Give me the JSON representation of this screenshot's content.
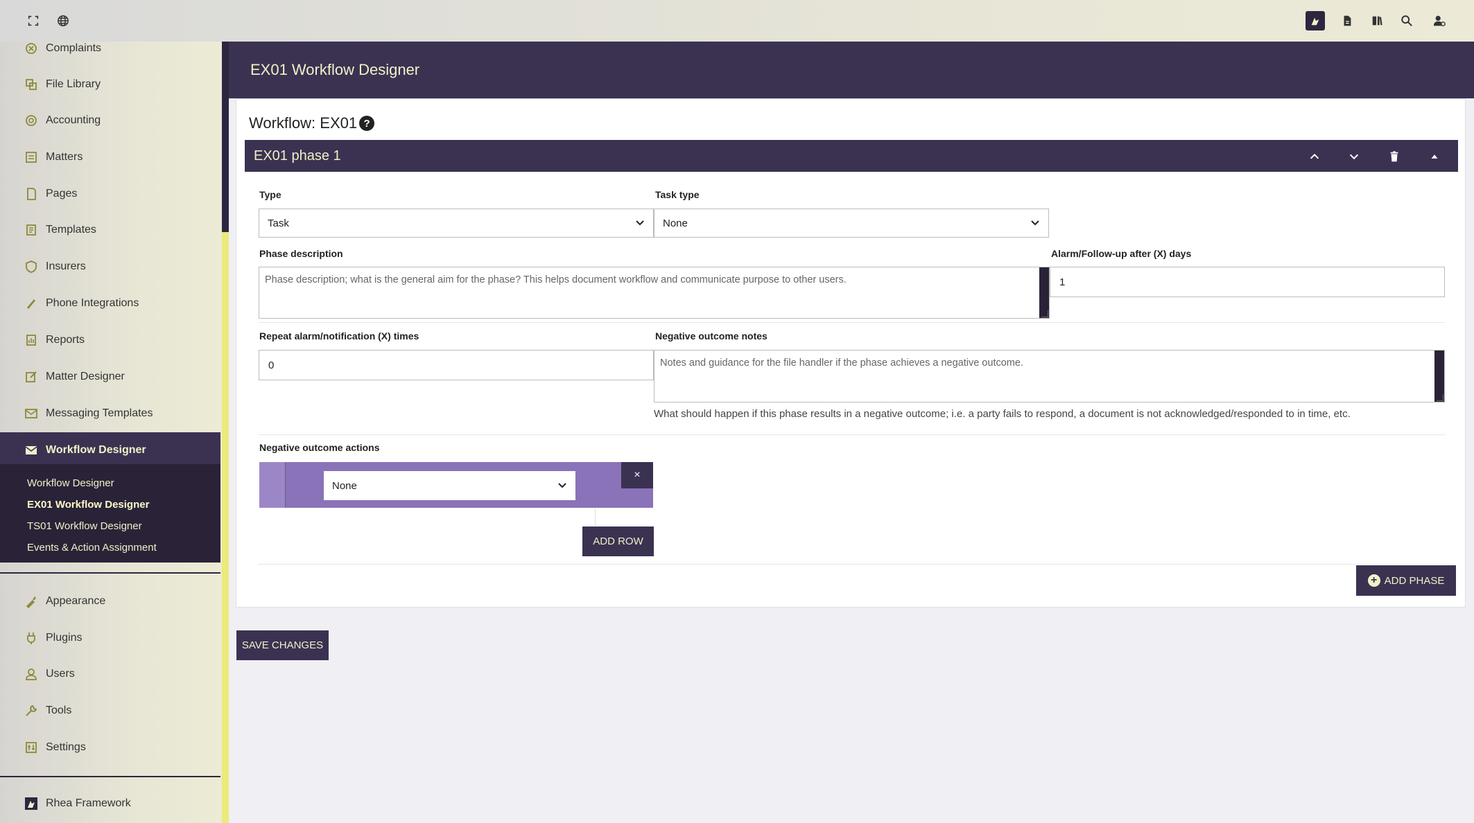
{
  "topbar": {
    "icons": [
      "fullscreen-icon",
      "globe-icon",
      "rhea-logo-icon",
      "document-icon",
      "book-icon",
      "search-icon",
      "user-settings-icon"
    ]
  },
  "sidebar": {
    "items": [
      {
        "label": "Complaints",
        "icon": "complaints-icon"
      },
      {
        "label": "File Library",
        "icon": "file-library-icon"
      },
      {
        "label": "Accounting",
        "icon": "accounting-icon"
      },
      {
        "label": "Matters",
        "icon": "matters-icon"
      },
      {
        "label": "Pages",
        "icon": "pages-icon"
      },
      {
        "label": "Templates",
        "icon": "templates-icon"
      },
      {
        "label": "Insurers",
        "icon": "insurers-icon"
      },
      {
        "label": "Phone Integrations",
        "icon": "phone-icon"
      },
      {
        "label": "Reports",
        "icon": "reports-icon"
      },
      {
        "label": "Matter Designer",
        "icon": "matter-designer-icon"
      },
      {
        "label": "Messaging Templates",
        "icon": "messaging-icon"
      },
      {
        "label": "Workflow Designer",
        "icon": "envelope-icon"
      },
      {
        "label": "Appearance",
        "icon": "appearance-icon"
      },
      {
        "label": "Plugins",
        "icon": "plugins-icon"
      },
      {
        "label": "Users",
        "icon": "users-icon"
      },
      {
        "label": "Tools",
        "icon": "tools-icon"
      },
      {
        "label": "Settings",
        "icon": "settings-icon"
      },
      {
        "label": "Rhea Framework",
        "icon": "rhea-icon"
      }
    ],
    "submenu": [
      "Workflow Designer",
      "EX01 Workflow Designer",
      "TS01 Workflow Designer",
      "Events & Action Assignment"
    ]
  },
  "page": {
    "title": "EX01 Workflow Designer",
    "workflow_label": "Workflow: EX01",
    "help_glyph": "?"
  },
  "phase": {
    "title": "EX01 phase 1",
    "type_label": "Type",
    "type_value": "Task",
    "task_type_label": "Task type",
    "task_type_value": "None",
    "description_label": "Phase description",
    "description_placeholder": "Phase description; what is the general aim for the phase? This helps document workflow and communicate purpose to other users.",
    "alarm_label": "Alarm/Follow-up after (X) days",
    "alarm_value": "1",
    "repeat_label": "Repeat alarm/notification (X) times",
    "repeat_value": "0",
    "neg_notes_label": "Negative outcome notes",
    "neg_notes_placeholder": "Notes and guidance for the file handler if the phase achieves a negative outcome.",
    "neg_notes_help": "What should happen if this phase results in a negative outcome; i.e. a party fails to respond, a document is not acknowledged/responded to in time, etc.",
    "neg_actions_label": "Negative outcome actions",
    "neg_action_value": "None",
    "remove_glyph": "×",
    "add_row_label": "ADD ROW"
  },
  "buttons": {
    "add_phase": "ADD PHASE",
    "add_phase_glyph": "+",
    "save_changes": "SAVE CHANGES"
  }
}
